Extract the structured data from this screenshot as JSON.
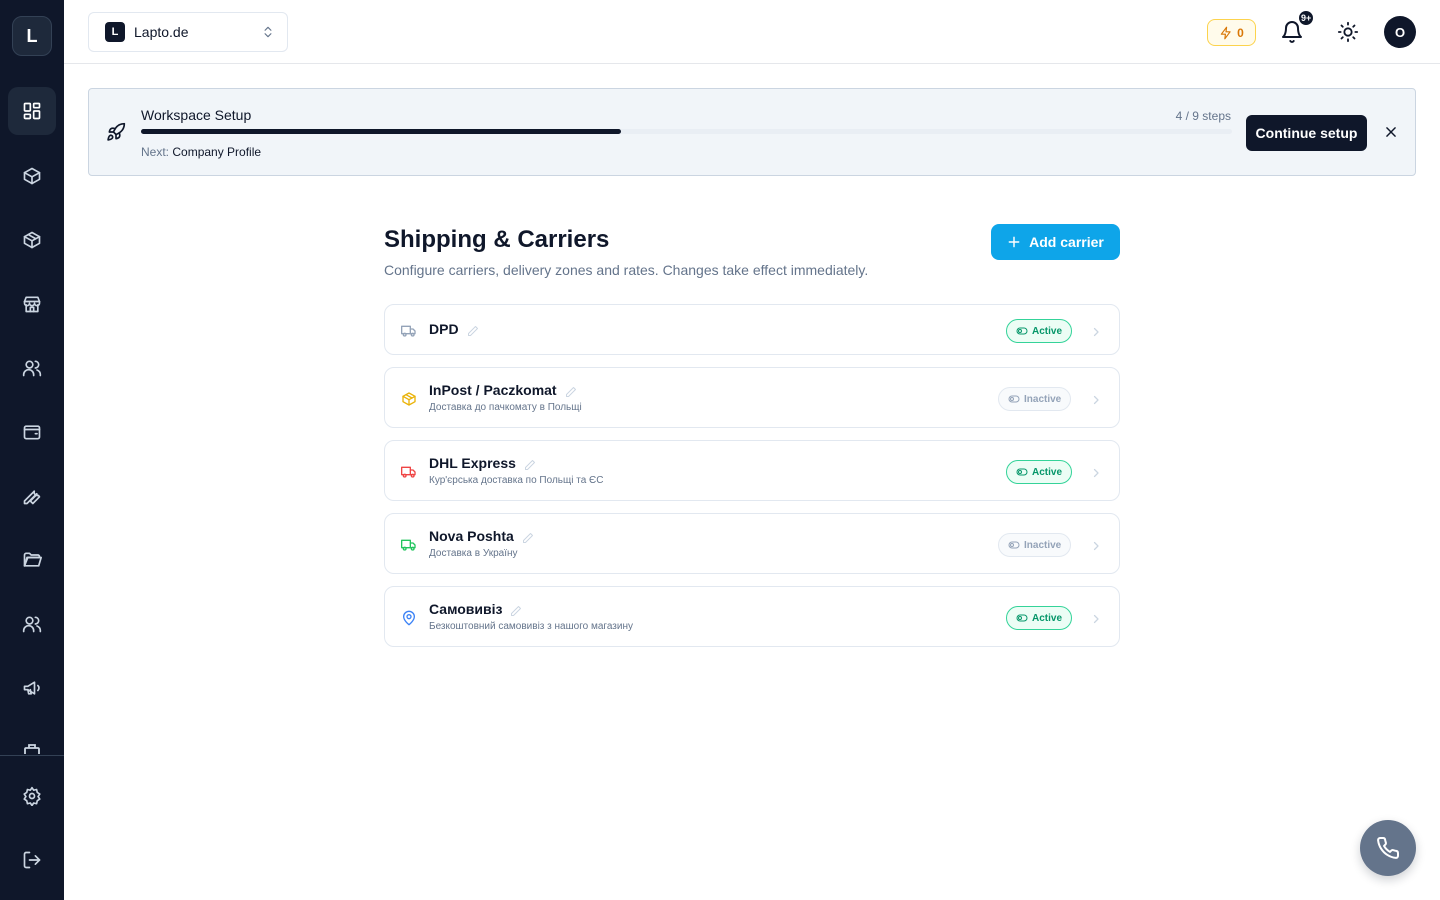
{
  "sidebar": {
    "logo": "L",
    "items": [
      {
        "icon": "dashboard-icon",
        "active": true
      },
      {
        "icon": "box-icon"
      },
      {
        "icon": "package-icon"
      },
      {
        "icon": "store-icon"
      },
      {
        "icon": "users-icon"
      },
      {
        "icon": "wallet-icon"
      },
      {
        "icon": "wrench-icon"
      },
      {
        "icon": "folder-icon"
      },
      {
        "icon": "team-icon"
      },
      {
        "icon": "megaphone-icon"
      }
    ],
    "bottom": [
      {
        "icon": "settings-icon"
      },
      {
        "icon": "logout-icon"
      }
    ]
  },
  "topbar": {
    "workspace_badge": "L",
    "workspace_name": "Lapto.de",
    "credits": "0",
    "notifications_badge": "9+",
    "avatar_initial": "O"
  },
  "setup": {
    "title": "Workspace Setup",
    "steps": "4 / 9 steps",
    "progress": 0.44,
    "next_label": "Next:",
    "next_value": "Company Profile",
    "continue_label": "Continue setup"
  },
  "page": {
    "title": "Shipping & Carriers",
    "subtitle": "Configure carriers, delivery zones and rates. Changes take effect immediately.",
    "add_label": "Add carrier"
  },
  "carriers": [
    {
      "name": "DPD",
      "description": "",
      "status": "Active",
      "active": true,
      "icon": "truck-icon",
      "icon_color": "#94a3b8"
    },
    {
      "name": "InPost / Paczkomat",
      "description": "Доставка до пачкомату в Польщі",
      "status": "Inactive",
      "active": false,
      "icon": "box-icon",
      "icon_color": "#eab308"
    },
    {
      "name": "DHL Express",
      "description": "Кур'єрська доставка по Польщі та ЄС",
      "status": "Active",
      "active": true,
      "icon": "truck-icon",
      "icon_color": "#ef4444"
    },
    {
      "name": "Nova Poshta",
      "description": "Доставка в Україну",
      "status": "Inactive",
      "active": false,
      "icon": "truck-icon",
      "icon_color": "#22c55e"
    },
    {
      "name": "Самовивіз",
      "description": "Безкоштовний самовивіз з нашого магазину",
      "status": "Active",
      "active": true,
      "icon": "map-pin-icon",
      "icon_color": "#3b82f6"
    }
  ],
  "colors": {
    "sidebar_bg": "#0f172a",
    "accent": "#0ea5e9",
    "active_green": "#059669"
  }
}
